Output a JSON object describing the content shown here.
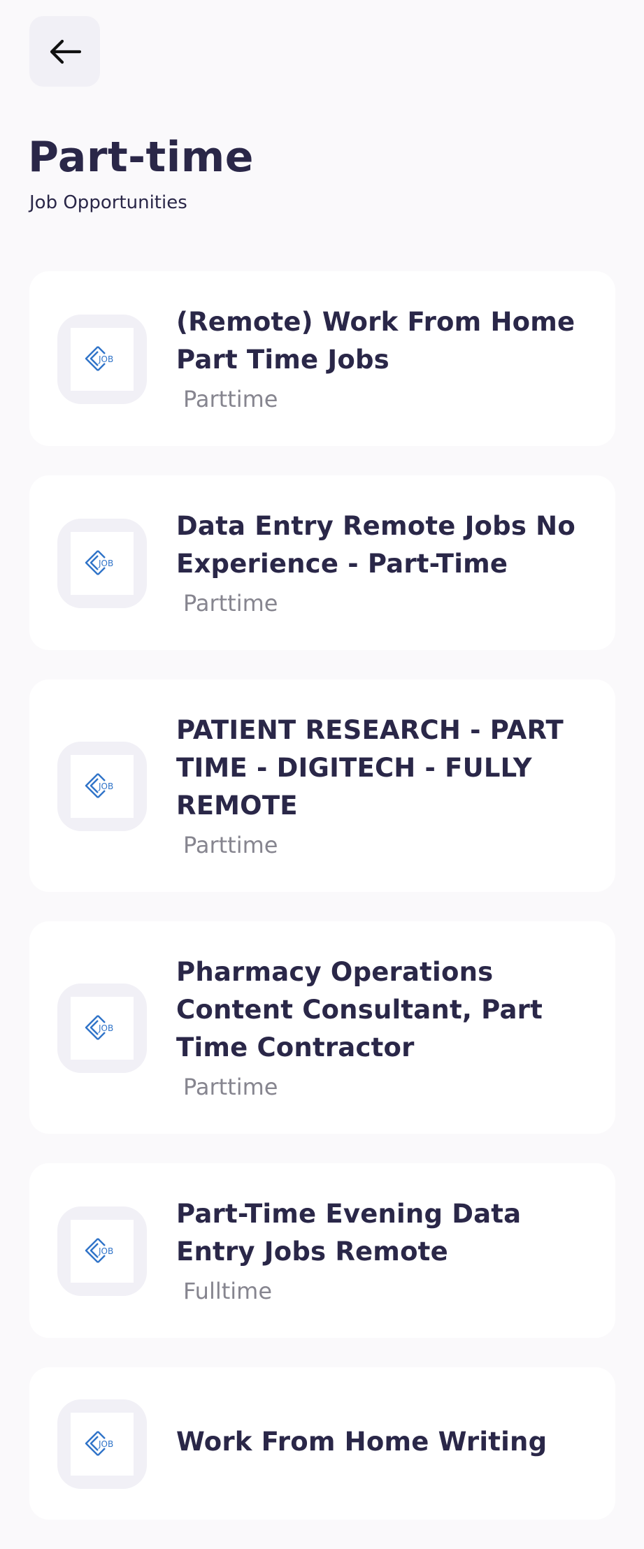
{
  "header": {
    "back_icon": "arrow-left-icon",
    "title": "Part-time",
    "subtitle": "Job Opportunities"
  },
  "logo": {
    "icon": "job-logo-icon",
    "text": "JOB",
    "color": "#2f73c8"
  },
  "jobs": [
    {
      "title": "(Remote) Work From Home Part Time Jobs",
      "type": "Parttime"
    },
    {
      "title": "Data Entry Remote Jobs No Experience - Part-Time",
      "type": "Parttime"
    },
    {
      "title": "PATIENT RESEARCH - PART TIME - DIGITECH - FULLY REMOTE",
      "type": "Parttime"
    },
    {
      "title": "Pharmacy Operations Content Consultant, Part Time Contractor",
      "type": "Parttime"
    },
    {
      "title": "Part-Time Evening Data Entry Jobs Remote",
      "type": "Fulltime"
    },
    {
      "title": "Work From Home Writing",
      "type": ""
    }
  ]
}
